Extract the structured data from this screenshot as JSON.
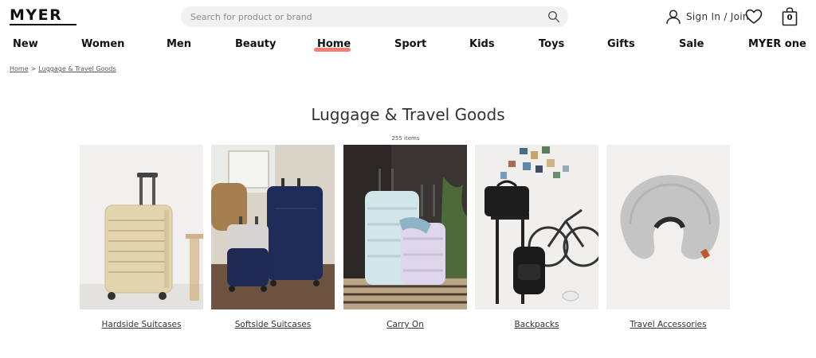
{
  "header": {
    "logo": "MYER",
    "search_placeholder": "Search for product or brand",
    "sign_in_label": "Sign In / Join",
    "bag_count": "0"
  },
  "nav": {
    "items": [
      "New",
      "Women",
      "Men",
      "Beauty",
      "Home",
      "Sport",
      "Kids",
      "Toys",
      "Gifts",
      "Sale",
      "MYER one"
    ],
    "active": "Home",
    "accent_color": "#f07f75"
  },
  "breadcrumb": {
    "home": "Home",
    "separator": ">",
    "current": "Luggage & Travel Goods"
  },
  "page": {
    "title": "Luggage & Travel Goods",
    "item_count": "255 items"
  },
  "categories": [
    {
      "label": "Hardside Suitcases"
    },
    {
      "label": "Softside Suitcases"
    },
    {
      "label": "Carry On"
    },
    {
      "label": "Backpacks"
    },
    {
      "label": "Travel Accessories"
    }
  ]
}
